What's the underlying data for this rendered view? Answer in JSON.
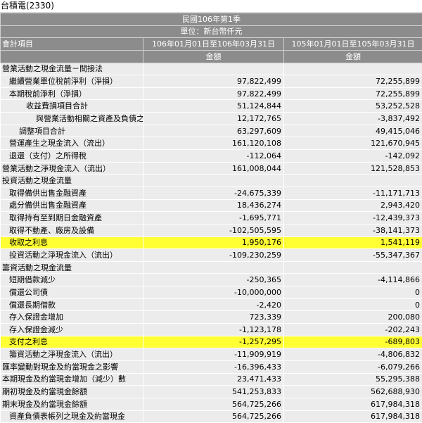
{
  "company": "台積電(2330)",
  "header": {
    "period_title": "民國106年第1季",
    "unit": "單位：新台幣仟元",
    "col_item": "會計項目",
    "col_cur": "106年01月01日至106年03月31日",
    "col_prev": "105年01月01日至105年03月31日",
    "amount_label": "金額"
  },
  "rows": [
    {
      "label": "營業活動之現金流量－間接法",
      "cur": "",
      "prev": "",
      "indent": 0,
      "hl": false
    },
    {
      "label": "繼續營業單位稅前淨利（淨損）",
      "cur": "97,822,499",
      "prev": "72,255,899",
      "indent": 1,
      "hl": false
    },
    {
      "label": "本期稅前淨利（淨損）",
      "cur": "97,822,499",
      "prev": "72,255,899",
      "indent": 1,
      "hl": false
    },
    {
      "label": "收益費損項目合計",
      "cur": "51,124,844",
      "prev": "53,252,528",
      "indent": 2,
      "hl": false
    },
    {
      "label": "與營業活動相關之資產及負債之",
      "cur": "12,172,765",
      "prev": "-3,837,492",
      "indent": 3,
      "hl": false
    },
    {
      "label": "調整項目合計",
      "cur": "63,297,609",
      "prev": "49,415,046",
      "indent": 4,
      "hl": false
    },
    {
      "label": "營運產生之現金流入（流出）",
      "cur": "161,120,108",
      "prev": "121,670,945",
      "indent": 1,
      "hl": false
    },
    {
      "label": "退還（支付）之所得稅",
      "cur": "-112,064",
      "prev": "-142,092",
      "indent": 1,
      "hl": false
    },
    {
      "label": "營業活動之淨現金流入（流出）",
      "cur": "161,008,044",
      "prev": "121,528,853",
      "indent": 0,
      "hl": false
    },
    {
      "label": "投資活動之現金流量",
      "cur": "",
      "prev": "",
      "indent": 0,
      "hl": false
    },
    {
      "label": "取得備供出售金融資產",
      "cur": "-24,675,339",
      "prev": "-11,171,713",
      "indent": 1,
      "hl": false
    },
    {
      "label": "處分備供出售金融資產",
      "cur": "18,436,274",
      "prev": "2,943,420",
      "indent": 1,
      "hl": false
    },
    {
      "label": "取得持有至到期日金融資產",
      "cur": "-1,695,771",
      "prev": "-12,439,373",
      "indent": 1,
      "hl": false
    },
    {
      "label": "取得不動產、廠房及設備",
      "cur": "-102,505,595",
      "prev": "-38,141,373",
      "indent": 1,
      "hl": false
    },
    {
      "label": "收取之利息",
      "cur": "1,950,176",
      "prev": "1,541,119",
      "indent": 1,
      "hl": true
    },
    {
      "label": "投資活動之淨現金流入（流出）",
      "cur": "-109,230,259",
      "prev": "-55,347,367",
      "indent": 1,
      "hl": false
    },
    {
      "label": "籌資活動之現金流量",
      "cur": "",
      "prev": "",
      "indent": 0,
      "hl": false
    },
    {
      "label": "短期借款減少",
      "cur": "-250,365",
      "prev": "-4,114,866",
      "indent": 1,
      "hl": false
    },
    {
      "label": "償還公司債",
      "cur": "-10,000,000",
      "prev": "0",
      "indent": 1,
      "hl": false
    },
    {
      "label": "償還長期借款",
      "cur": "-2,420",
      "prev": "0",
      "indent": 1,
      "hl": false
    },
    {
      "label": "存入保證金增加",
      "cur": "723,339",
      "prev": "200,080",
      "indent": 1,
      "hl": false
    },
    {
      "label": "存入保證金減少",
      "cur": "-1,123,178",
      "prev": "-202,243",
      "indent": 1,
      "hl": false
    },
    {
      "label": "支付之利息",
      "cur": "-1,257,295",
      "prev": "-689,803",
      "indent": 1,
      "hl": true
    },
    {
      "label": "籌資活動之淨現金流入（流出）",
      "cur": "-11,909,919",
      "prev": "-4,806,832",
      "indent": 1,
      "hl": false
    },
    {
      "label": "匯率變動對現金及約當現金之影響",
      "cur": "-16,396,433",
      "prev": "-6,079,266",
      "indent": 0,
      "hl": false
    },
    {
      "label": "本期現金及約當現金增加（減少）數",
      "cur": "23,471,433",
      "prev": "55,295,388",
      "indent": 0,
      "hl": false
    },
    {
      "label": "期初現金及約當現金餘額",
      "cur": "541,253,833",
      "prev": "562,688,930",
      "indent": 0,
      "hl": false
    },
    {
      "label": "期末現金及約當現金餘額",
      "cur": "564,725,266",
      "prev": "617,984,318",
      "indent": 0,
      "hl": false
    },
    {
      "label": "資產負債表帳列之現金及約當現金",
      "cur": "564,725,266",
      "prev": "617,984,318",
      "indent": 1,
      "hl": false
    }
  ]
}
